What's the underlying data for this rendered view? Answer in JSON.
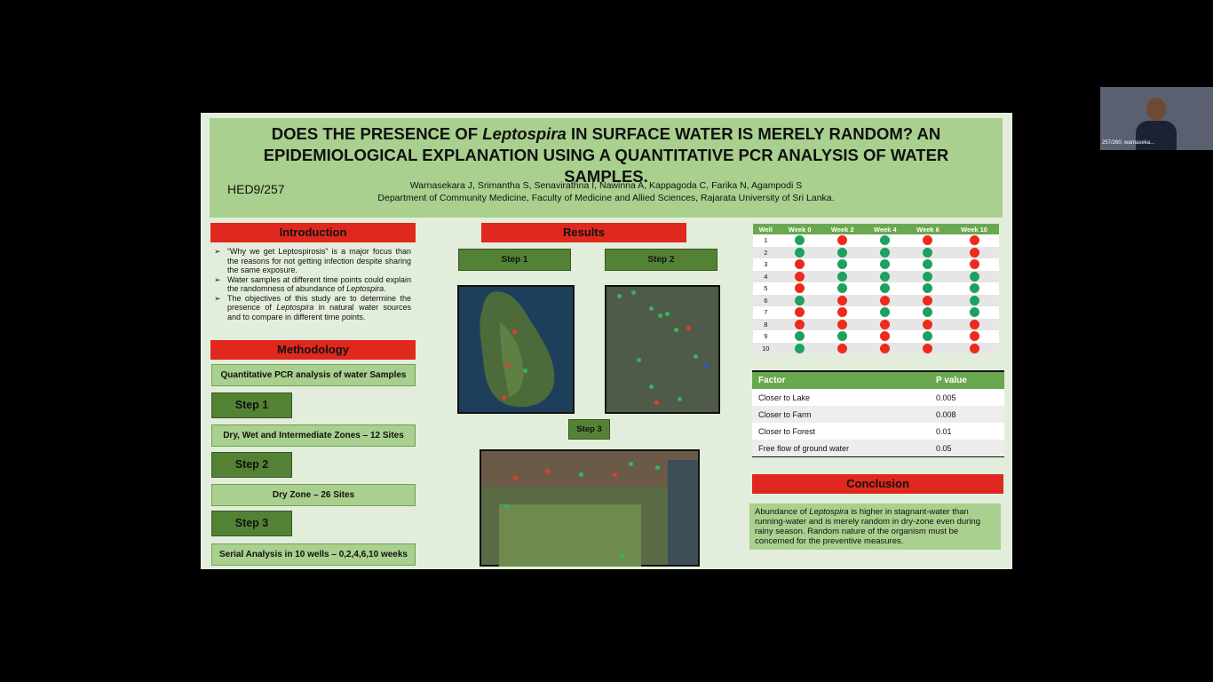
{
  "poster": {
    "title_lines": [
      {
        "pre": "DOES THE PRESENCE OF ",
        "ital": "Leptospira",
        "post": " IN SURFACE WATER IS MERELY RANDOM? AN"
      },
      {
        "pre": "EPIDEMIOLOGICAL EXPLANATION USING A QUANTITATIVE PCR ANALYSIS OF WATER",
        "ital": "",
        "post": ""
      },
      {
        "pre": "SAMPLES.",
        "ital": "",
        "post": ""
      }
    ],
    "code": "HED9/257",
    "authors": "Warnasekara J, Srimantha S, Senavirathna I, Nawinna A, Kappagoda C, Farika N, Agampodi S",
    "affiliation": "Department of Community Medicine, Faculty of Medicine and Allied Sciences, Rajarata University of Sri Lanka."
  },
  "introduction": {
    "heading": "Introduction",
    "bullets": [
      {
        "pre": "“Why we get Leptospirosis” is a major focus than the reasons for not getting infection despite sharing the same exposure.",
        "ital": "",
        "post": ""
      },
      {
        "pre": "Water samples at different time points could explain the randomness of abundance of ",
        "ital": "Leptospira",
        "post": "."
      },
      {
        "pre": "The objectives of this study are to determine the presence of ",
        "ital": "Leptospira",
        "post": " in natural water sources and to compare in different time points."
      }
    ],
    "bullet_symbol": "➢"
  },
  "methodology": {
    "heading": "Methodology",
    "qpcr": "Quantitative PCR analysis of water Samples",
    "steps": [
      {
        "label": "Step 1",
        "desc": "Dry, Wet and Intermediate Zones – 12 Sites"
      },
      {
        "label": "Step 2",
        "desc": "Dry Zone – 26 Sites"
      },
      {
        "label": "Step 3",
        "desc": "Serial Analysis in 10 wells – 0,2,4,6,10 weeks"
      }
    ]
  },
  "results": {
    "heading": "Results",
    "step1": "Step 1",
    "step2": "Step 2",
    "step3": "Step 3"
  },
  "wells_table": {
    "headers": [
      "Well",
      "Week 0",
      "Week 2",
      "Week 4",
      "Week 6",
      "Week 10"
    ],
    "rows": [
      {
        "well": "1",
        "status": [
          "g",
          "r",
          "g",
          "r",
          "r"
        ]
      },
      {
        "well": "2",
        "status": [
          "g",
          "g",
          "g",
          "g",
          "r"
        ]
      },
      {
        "well": "3",
        "status": [
          "r",
          "g",
          "g",
          "g",
          "r"
        ]
      },
      {
        "well": "4",
        "status": [
          "r",
          "g",
          "g",
          "g",
          "g"
        ]
      },
      {
        "well": "5",
        "status": [
          "r",
          "g",
          "g",
          "g",
          "g"
        ]
      },
      {
        "well": "6",
        "status": [
          "g",
          "r",
          "r",
          "r",
          "g"
        ]
      },
      {
        "well": "7",
        "status": [
          "r",
          "r",
          "g",
          "g",
          "g"
        ]
      },
      {
        "well": "8",
        "status": [
          "r",
          "r",
          "r",
          "r",
          "r"
        ]
      },
      {
        "well": "9",
        "status": [
          "g",
          "g",
          "r",
          "g",
          "r"
        ]
      },
      {
        "well": "10",
        "status": [
          "g",
          "r",
          "r",
          "r",
          "r"
        ]
      }
    ],
    "colors": {
      "g": "#1ea060",
      "r": "#ee2a1c"
    }
  },
  "factor_table": {
    "headers": [
      "Factor",
      "P value"
    ],
    "rows": [
      {
        "factor": "Closer to Lake",
        "p": "0.005"
      },
      {
        "factor": "Closer to Farm",
        "p": "0.008"
      },
      {
        "factor": "Closer to Forest",
        "p": "0.01"
      },
      {
        "factor": "Free flow of ground water",
        "p": "0.05"
      }
    ]
  },
  "conclusion": {
    "heading": "Conclusion",
    "pre": "Abundance of ",
    "ital": "Leptospira",
    "post": " is higher in stagnant-water than running-water and is merely random in dry-zone even during rainy season. Random nature of the organism must be concerned for the preventive measures."
  },
  "webcam": {
    "label": "257/260, warnaseka..."
  }
}
